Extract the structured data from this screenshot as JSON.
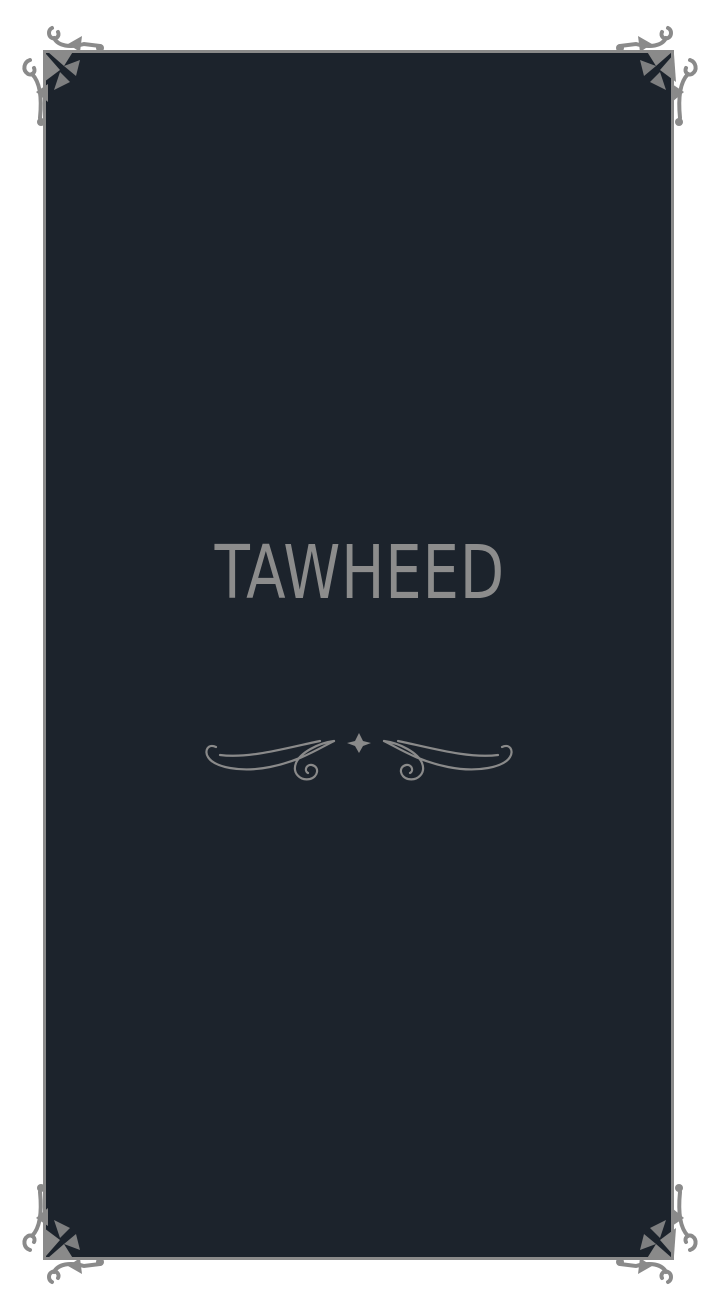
{
  "title": "TAWHEED",
  "colors": {
    "background": "#ffffff",
    "panel": "#1c232c",
    "ornament": "#8a8a8a",
    "title_text": "#8c8c8c"
  },
  "ornaments": {
    "corners": "floral-corner-icon",
    "divider": "flourish-divider-icon"
  }
}
